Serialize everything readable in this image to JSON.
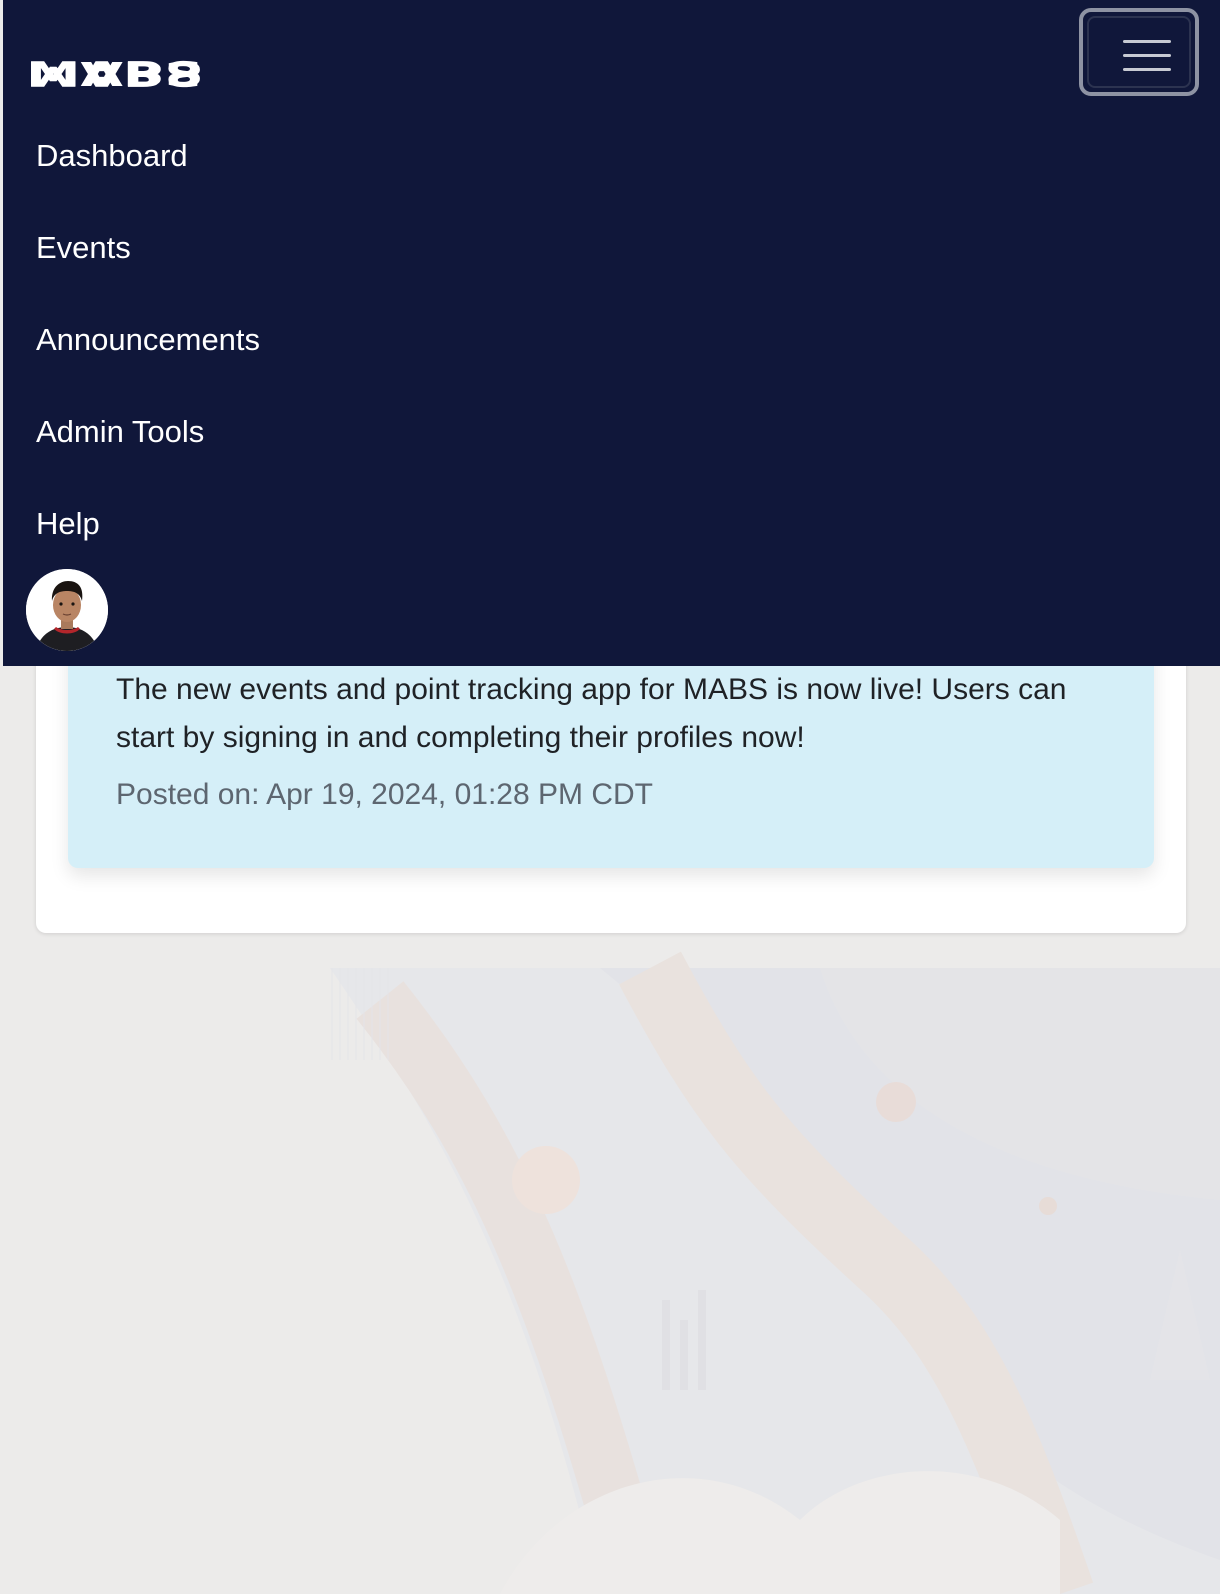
{
  "navbar": {
    "brand": {
      "logo_text": "MABS",
      "logo_icon": "mabs-logo"
    },
    "toggler_icon": "hamburger-menu-icon",
    "items": [
      {
        "label": "Dashboard"
      },
      {
        "label": "Events"
      },
      {
        "label": "Announcements"
      },
      {
        "label": "Admin Tools"
      },
      {
        "label": "Help"
      }
    ],
    "avatar_icon": "user-avatar"
  },
  "announcement": {
    "body": "The new events and point tracking app for MABS is now live! Users can start by signing in and completing their profiles now!",
    "posted": "Posted on: Apr 19, 2024, 01:28 PM CDT"
  },
  "colors": {
    "navbar_bg": "#10173a",
    "announcement_bg": "#d5eff8",
    "page_bg": "#ecebea",
    "text_muted": "#5d6670"
  }
}
